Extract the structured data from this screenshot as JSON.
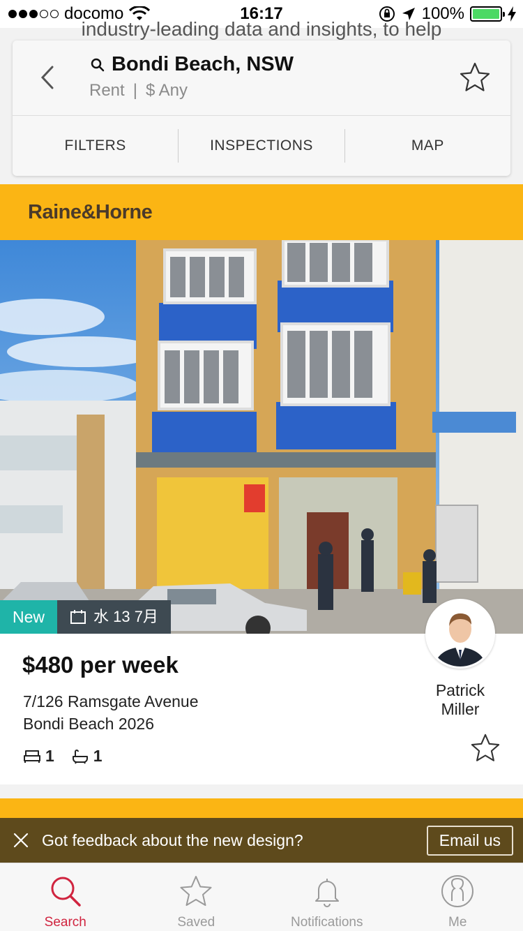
{
  "status_bar": {
    "carrier": "docomo",
    "time": "16:17",
    "battery": "100%",
    "battery_level": 1.0,
    "signal_bars_filled": 3,
    "signal_bars_total": 5
  },
  "behind_text": "industry-leading data and insights, to help",
  "search": {
    "location": "Bondi Beach, NSW",
    "mode": "Rent",
    "separator": "|",
    "price": "$ Any",
    "tabs": [
      "FILTERS",
      "INSPECTIONS",
      "MAP"
    ]
  },
  "listing": {
    "agency": "Raine&Horne",
    "agency_color": "#fbb514",
    "badge_new": "New",
    "inspection_date": "水 13 7月",
    "price": "$480 per week",
    "address_line1": "7/126 Ramsgate Avenue",
    "address_line2": "Bondi Beach 2026",
    "beds": "1",
    "baths": "1",
    "agent_name": "Patrick Miller"
  },
  "feedback": {
    "text": "Got feedback about the new design?",
    "button": "Email us"
  },
  "tabbar": {
    "items": [
      {
        "label": "Search",
        "icon": "search-icon",
        "active": true
      },
      {
        "label": "Saved",
        "icon": "star-icon",
        "active": false
      },
      {
        "label": "Notifications",
        "icon": "bell-icon",
        "active": false
      },
      {
        "label": "Me",
        "icon": "user-icon",
        "active": false
      }
    ],
    "active_color": "#d0243f"
  }
}
